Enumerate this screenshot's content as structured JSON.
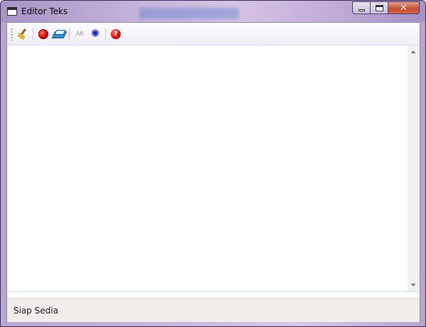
{
  "window": {
    "title": "Editor Teks"
  },
  "toolbar": {
    "buttons": [
      {
        "name": "clear",
        "icon": "broom-icon"
      },
      {
        "name": "record",
        "icon": "red-circle-icon"
      },
      {
        "name": "open-book",
        "icon": "book-icon"
      },
      {
        "name": "font",
        "icon": "ab-font-icon",
        "label": "A6"
      },
      {
        "name": "settings",
        "icon": "gear-icon",
        "glyph": "✺"
      },
      {
        "name": "help",
        "icon": "help-icon",
        "glyph": "?"
      }
    ]
  },
  "editor": {
    "value": ""
  },
  "statusbar": {
    "text": "Siap Sedia"
  },
  "colors": {
    "title_glass": "#c7b6dc",
    "close_button": "#c64a2f",
    "statusbar_bg": "#f0edeb"
  }
}
